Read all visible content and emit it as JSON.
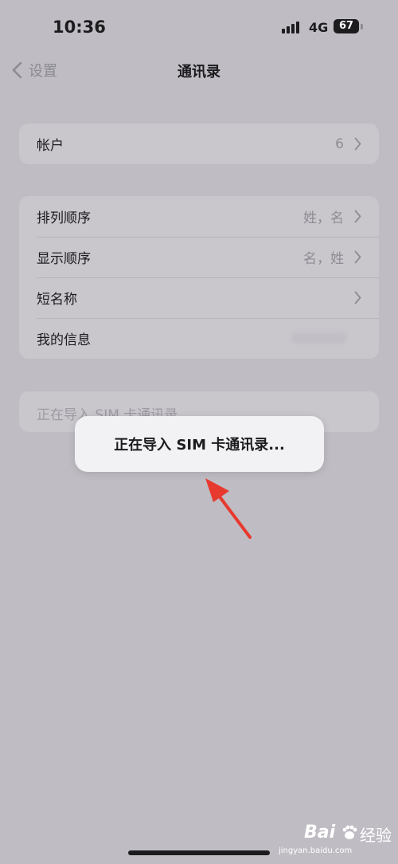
{
  "status_bar": {
    "time": "10:36",
    "network": "4G",
    "battery": "67"
  },
  "nav": {
    "back_label": "设置",
    "title": "通讯录"
  },
  "group1": [
    {
      "label": "帐户",
      "value": "6"
    }
  ],
  "group2": [
    {
      "label": "排列顺序",
      "value": "姓，名"
    },
    {
      "label": "显示顺序",
      "value": "名，姓"
    },
    {
      "label": "短名称",
      "value": ""
    },
    {
      "label": "我的信息",
      "value": ""
    }
  ],
  "import_row": {
    "label": "正在导入 SIM 卡通讯录..."
  },
  "toast": {
    "message": "正在导入 SIM 卡通讯录..."
  },
  "watermark": {
    "brand": "Bai",
    "text": "经验",
    "sub": "jingyan.baidu.com"
  },
  "colors": {
    "background": "#bfbcc3",
    "cell": "#c9c6cc",
    "toast": "#f2f1f4",
    "annotation_arrow": "#e8392f"
  }
}
